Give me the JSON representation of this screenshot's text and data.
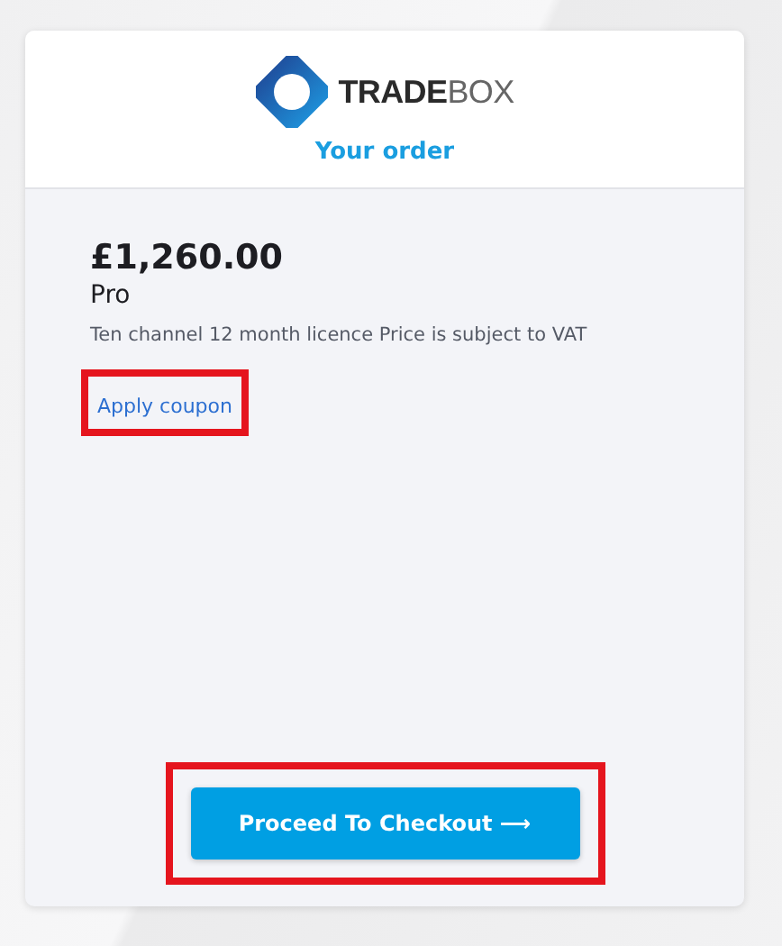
{
  "logo": {
    "bold": "TRADE",
    "light": "BOX"
  },
  "heading": "Your order",
  "order": {
    "price": "£1,260.00",
    "plan": "Pro",
    "description": "Ten channel 12 month licence Price is subject to VAT"
  },
  "coupon_link": {
    "label": "Apply coupon",
    "highlighted": true
  },
  "checkout_button": {
    "label": "Proceed To Checkout ⟶",
    "highlighted": true
  }
}
